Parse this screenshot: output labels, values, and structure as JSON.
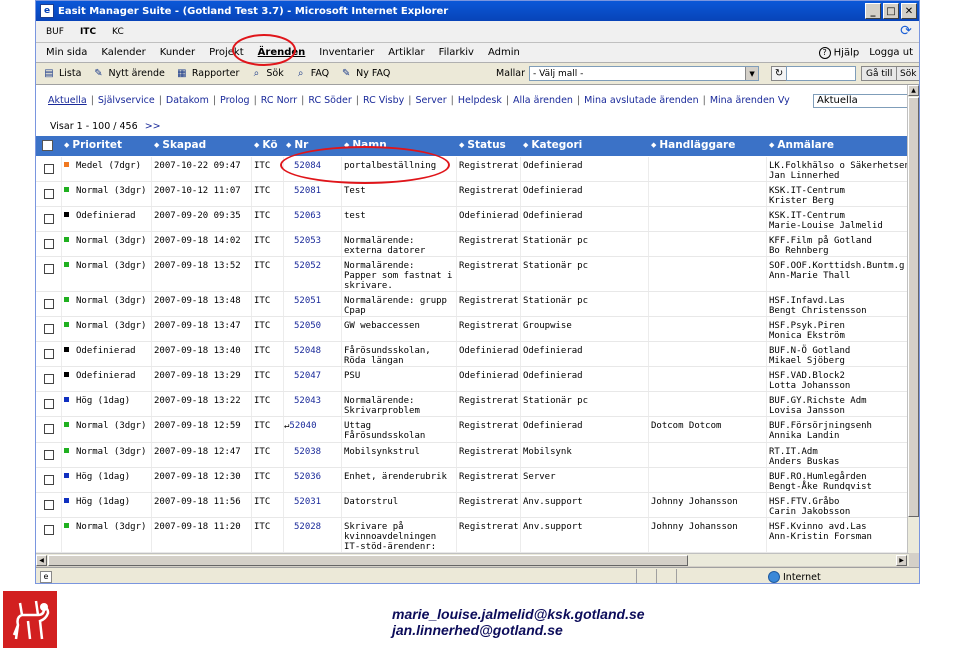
{
  "window": {
    "title": "Easit Manager Suite - (Gotland Test 3.7) - Microsoft Internet Explorer",
    "controls": [
      "_",
      "□",
      "✕"
    ]
  },
  "top_tabs": [
    "BUF",
    "ITC",
    "KC"
  ],
  "main_menu": {
    "items": [
      "Min sida",
      "Kalender",
      "Kunder",
      "Projekt",
      "Ärenden",
      "Inventarier",
      "Artiklar",
      "Filarkiv",
      "Admin"
    ],
    "right": {
      "help": "Hjälp",
      "logout": "Logga ut"
    }
  },
  "toolbar": {
    "buttons": [
      "Lista",
      "Nytt ärende",
      "Rapporter",
      "Sök",
      "FAQ",
      "Ny FAQ"
    ],
    "mallar_label": "Mallar",
    "mallar_value": "- Välj mall -",
    "goto_label": "Gå till",
    "search_label": "Sök"
  },
  "views": {
    "links": [
      "Aktuella",
      "Självservice",
      "Datakom",
      "Prolog",
      "RC Norr",
      "RC Söder",
      "RC Visby",
      "Server",
      "Helpdesk",
      "Alla ärenden",
      "Mina avslutade ärenden",
      "Mina ärenden Vy"
    ],
    "selected_view": "Aktuella"
  },
  "paging": {
    "text": "Visar 1 - 100 / 456",
    "next": ">>"
  },
  "table": {
    "columns": [
      "Prioritet",
      "Skapad",
      "Kö",
      "Nr",
      "Namn",
      "Status",
      "Kategori",
      "Handläggare",
      "Anmälare"
    ],
    "rows": [
      {
        "prio": "Medel (7dgr)",
        "prio_color": "#f07820",
        "created": "2007-10-22 09:47",
        "queue": "ITC",
        "nr": "52084",
        "name": [
          "portalbeställning"
        ],
        "status": "Registrerat",
        "category": "Odefinierad",
        "handler": "",
        "reporter": [
          "LK.Folkhälso o Säkerhetsenh",
          "Jan Linnerhed"
        ]
      },
      {
        "prio": "Normal (3dgr)",
        "prio_color": "#20b020",
        "created": "2007-10-12 11:07",
        "queue": "ITC",
        "nr": "52081",
        "name": [
          "Test"
        ],
        "status": "Registrerat",
        "category": "Odefinierad",
        "handler": "",
        "reporter": [
          "KSK.IT-Centrum",
          "Krister Berg"
        ]
      },
      {
        "prio": "Odefinierad",
        "prio_color": "#000000",
        "created": "2007-09-20 09:35",
        "queue": "ITC",
        "nr": "52063",
        "name": [
          "test"
        ],
        "status": "Odefinierad",
        "category": "Odefinierad",
        "handler": "",
        "reporter": [
          "KSK.IT-Centrum",
          "Marie-Louise Jalmelid"
        ]
      },
      {
        "prio": "Normal (3dgr)",
        "prio_color": "#20b020",
        "created": "2007-09-18 14:02",
        "queue": "ITC",
        "nr": "52053",
        "name": [
          "Normalärende:",
          "externa datorer"
        ],
        "status": "Registrerat",
        "category": "Stationär pc",
        "handler": "",
        "reporter": [
          "KFF.Film på Gotland",
          "Bo Rehnberg"
        ]
      },
      {
        "prio": "Normal (3dgr)",
        "prio_color": "#20b020",
        "created": "2007-09-18 13:52",
        "queue": "ITC",
        "nr": "52052",
        "name": [
          "Normalärende:",
          "Papper som fastnat i",
          "skrivare."
        ],
        "status": "Registrerat",
        "category": "Stationär pc",
        "handler": "",
        "reporter": [
          "SOF.OOF.Korttidsh.Buntm.g",
          "Ann-Marie Thall"
        ]
      },
      {
        "prio": "Normal (3dgr)",
        "prio_color": "#20b020",
        "created": "2007-09-18 13:48",
        "queue": "ITC",
        "nr": "52051",
        "name": [
          "Normalärende: grupp",
          "Cpap"
        ],
        "status": "Registrerat",
        "category": "Stationär pc",
        "handler": "",
        "reporter": [
          "HSF.Infavd.Las",
          "Bengt Christensson"
        ]
      },
      {
        "prio": "Normal (3dgr)",
        "prio_color": "#20b020",
        "created": "2007-09-18 13:47",
        "queue": "ITC",
        "nr": "52050",
        "name": [
          "GW webaccessen"
        ],
        "status": "Registrerat",
        "category": "Groupwise",
        "handler": "",
        "reporter": [
          "HSF.Psyk.Piren",
          "Monica Ekström"
        ]
      },
      {
        "prio": "Odefinierad",
        "prio_color": "#000000",
        "created": "2007-09-18 13:40",
        "queue": "ITC",
        "nr": "52048",
        "name": [
          "Fårösundsskolan,",
          "Röda längan"
        ],
        "status": "Odefinierad",
        "category": "Odefinierad",
        "handler": "",
        "reporter": [
          "BUF.N-Ö Gotland",
          "Mikael Sjöberg"
        ]
      },
      {
        "prio": "Odefinierad",
        "prio_color": "#000000",
        "created": "2007-09-18 13:29",
        "queue": "ITC",
        "nr": "52047",
        "name": [
          "PSU"
        ],
        "status": "Odefinierad",
        "category": "Odefinierad",
        "handler": "",
        "reporter": [
          "HSF.VAD.Block2",
          "Lotta Johansson"
        ]
      },
      {
        "prio": "Hög (1dag)",
        "prio_color": "#1030c0",
        "created": "2007-09-18 13:22",
        "queue": "ITC",
        "nr": "52043",
        "name": [
          "Normalärende:",
          "Skrivarproblem"
        ],
        "status": "Registrerat",
        "category": "Stationär pc",
        "handler": "",
        "reporter": [
          "BUF.GY.Richste Adm",
          "Lovisa Jansson"
        ]
      },
      {
        "prio": "Normal (3dgr)",
        "prio_color": "#20b020",
        "created": "2007-09-18 12:59",
        "queue": "ITC",
        "nr": "52040",
        "nr_prefix": "↵",
        "name": [
          "Uttag",
          "Fårösundsskolan"
        ],
        "status": "Registrerat",
        "category": "Odefinierad",
        "handler": "Dotcom Dotcom",
        "reporter": [
          "BUF.Försörjningsenh",
          "Annika Landin"
        ]
      },
      {
        "prio": "Normal (3dgr)",
        "prio_color": "#20b020",
        "created": "2007-09-18 12:47",
        "queue": "ITC",
        "nr": "52038",
        "name": [
          "Mobilsynkstrul"
        ],
        "status": "Registrerat",
        "category": "Mobilsynk",
        "handler": "",
        "reporter": [
          "RT.IT.Adm",
          "Anders Buskas"
        ]
      },
      {
        "prio": "Hög (1dag)",
        "prio_color": "#1030c0",
        "created": "2007-09-18 12:30",
        "queue": "ITC",
        "nr": "52036",
        "name": [
          "Enhet, ärenderubrik"
        ],
        "status": "Registrerat",
        "category": "Server",
        "handler": "",
        "reporter": [
          "BUF.RO.Humlegården",
          "Bengt-Åke Rundqvist"
        ]
      },
      {
        "prio": "Hög (1dag)",
        "prio_color": "#1030c0",
        "created": "2007-09-18 11:56",
        "queue": "ITC",
        "nr": "52031",
        "name": [
          "Datorstrul"
        ],
        "status": "Registrerat",
        "category": "Anv.support",
        "handler": "Johnny Johansson",
        "reporter": [
          "HSF.FTV.Gråbo",
          "Carin Jakobsson"
        ]
      },
      {
        "prio": "Normal (3dgr)",
        "prio_color": "#20b020",
        "created": "2007-09-18 11:20",
        "queue": "ITC",
        "nr": "52028",
        "name": [
          "Skrivare på",
          "kvinnoavdelningen",
          "IT-stöd-ärendenr:"
        ],
        "status": "Registrerat",
        "category": "Anv.support",
        "handler": "Johnny Johansson",
        "reporter": [
          "HSF.Kvinno avd.Las",
          "Ann-Kristin Forsman"
        ]
      }
    ]
  },
  "statusbar": {
    "zone": "Internet"
  },
  "footer": {
    "emails": [
      "marie_louise.jalmelid@ksk.gotland.se",
      "jan.linnerhed@gotland.se"
    ]
  },
  "colors": {
    "header_blue": "#3b72c7",
    "annotation_red": "#e0151a",
    "logo_red": "#d22020"
  }
}
